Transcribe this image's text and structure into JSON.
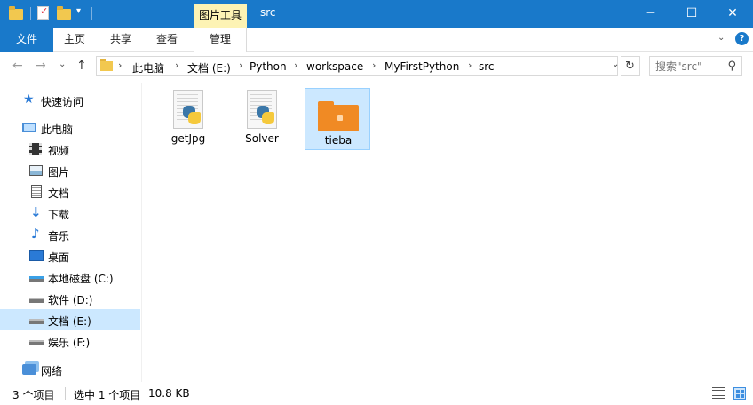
{
  "window": {
    "tools_tab": "图片工具",
    "title": "src",
    "minimize": "─",
    "maximize": "☐",
    "close": "✕"
  },
  "ribbon": {
    "file_tab": "文件",
    "tabs": [
      "主页",
      "共享",
      "查看",
      "管理"
    ],
    "expand": "⌄",
    "help": "?"
  },
  "nav": {
    "back": "←",
    "forward": "→",
    "recent": "⌄",
    "up": "↑",
    "breadcrumb": [
      "此电脑",
      "文档 (E:)",
      "Python",
      "workspace",
      "MyFirstPython",
      "src"
    ],
    "crumb_sep": "›",
    "dropdown": "⌄",
    "refresh": "↻"
  },
  "search": {
    "placeholder": "搜索\"src\"",
    "icon": "search-icon"
  },
  "sidebar": {
    "items": [
      {
        "label": "快速访问",
        "icon": "star-icon"
      },
      {
        "label": "此电脑",
        "icon": "computer-icon"
      },
      {
        "label": "视频",
        "icon": "video-icon"
      },
      {
        "label": "图片",
        "icon": "pictures-icon"
      },
      {
        "label": "文档",
        "icon": "documents-icon"
      },
      {
        "label": "下载",
        "icon": "download-icon"
      },
      {
        "label": "音乐",
        "icon": "music-icon"
      },
      {
        "label": "桌面",
        "icon": "desktop-icon"
      },
      {
        "label": "本地磁盘 (C:)",
        "icon": "system-drive-icon"
      },
      {
        "label": "软件 (D:)",
        "icon": "drive-icon"
      },
      {
        "label": "文档 (E:)",
        "icon": "drive-icon",
        "selected": true
      },
      {
        "label": "娱乐 (F:)",
        "icon": "drive-icon"
      },
      {
        "label": "网络",
        "icon": "network-icon"
      }
    ]
  },
  "files": [
    {
      "name": "getJpg",
      "type": "python-file"
    },
    {
      "name": "Solver",
      "type": "python-file"
    },
    {
      "name": "tieba",
      "type": "archive-folder",
      "selected": true
    }
  ],
  "status": {
    "item_count": "3 个项目",
    "selected": "选中 1 个项目",
    "size": "10.8 KB"
  },
  "colors": {
    "titlebar": "#1979ca",
    "tools_tab": "#fdf3b4",
    "selection": "#cce8ff",
    "zip_orange": "#f08a24"
  }
}
